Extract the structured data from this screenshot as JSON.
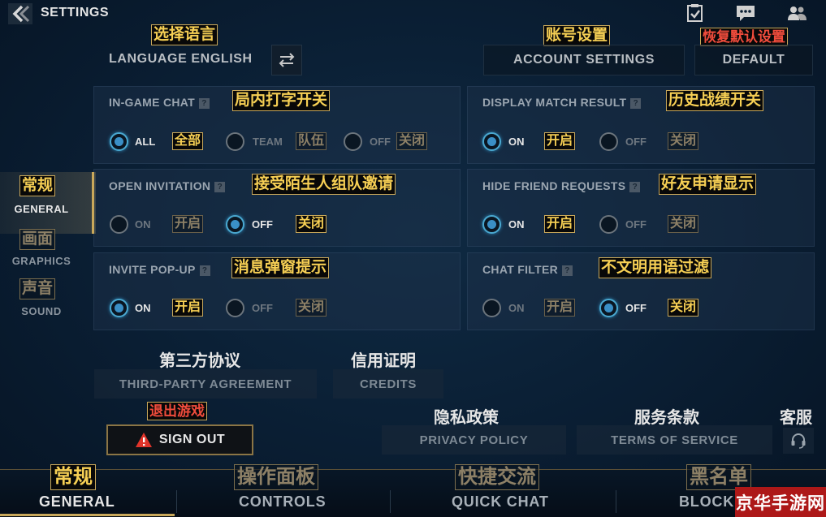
{
  "header": {
    "title": "SETTINGS"
  },
  "captions": {
    "language": "选择语言",
    "account": "账号设置",
    "default": "恢复默认设置",
    "in_game_chat": "局内打字开关",
    "display_match_result": "历史战绩开关",
    "open_invitation": "接受陌生人组队邀请",
    "hide_friend_requests": "好友申请显示",
    "invite_popup": "消息弹窗提示",
    "chat_filter": "不文明用语过滤",
    "sign_out": "退出游戏",
    "opt_all": "全部",
    "opt_team": "队伍",
    "opt_close": "关闭",
    "opt_open": "开启"
  },
  "language": {
    "label": "LANGUAGE ENGLISH",
    "icon": "swap-arrows-icon"
  },
  "top_buttons": {
    "account": "ACCOUNT SETTINGS",
    "default": "DEFAULT"
  },
  "settings": {
    "in_game_chat": {
      "label": "IN-GAME CHAT",
      "options": [
        "ALL",
        "TEAM",
        "OFF"
      ],
      "selected": "ALL"
    },
    "display_match_result": {
      "label": "DISPLAY MATCH RESULT",
      "options": [
        "ON",
        "OFF"
      ],
      "selected": "ON"
    },
    "open_invitation": {
      "label": "OPEN INVITATION",
      "options": [
        "ON",
        "OFF"
      ],
      "selected": "OFF"
    },
    "hide_friend_requests": {
      "label": "HIDE FRIEND REQUESTS",
      "options": [
        "ON",
        "OFF"
      ],
      "selected": "ON"
    },
    "invite_popup": {
      "label": "INVITE POP-UP",
      "options": [
        "ON",
        "OFF"
      ],
      "selected": "ON"
    },
    "chat_filter": {
      "label": "CHAT FILTER",
      "options": [
        "ON",
        "OFF"
      ],
      "selected": "OFF"
    }
  },
  "left_nav": [
    {
      "zh": "常规",
      "label": "GENERAL",
      "active": true
    },
    {
      "zh": "画面",
      "label": "GRAPHICS",
      "active": false
    },
    {
      "zh": "声音",
      "label": "SOUND",
      "active": false
    }
  ],
  "links": {
    "third_party_zh": "第三方协议",
    "third_party": "THIRD-PARTY AGREEMENT",
    "credits_zh": "信用证明",
    "credits": "CREDITS",
    "privacy_zh": "隐私政策",
    "privacy": "PRIVACY POLICY",
    "terms_zh": "服务条款",
    "terms": "TERMS OF SERVICE",
    "support_zh": "客服"
  },
  "sign_out": {
    "label": "SIGN OUT"
  },
  "footer_tabs": [
    {
      "zh": "常规",
      "label": "GENERAL",
      "active": true
    },
    {
      "zh": "操作面板",
      "label": "CONTROLS",
      "active": false
    },
    {
      "zh": "快捷交流",
      "label": "QUICK CHAT",
      "active": false
    },
    {
      "zh": "黑名单",
      "label": "BLOCK",
      "active": false
    }
  ],
  "watermark": "京华手游网",
  "colors": {
    "accent_gold": "#c9a85a",
    "caption_yellow": "#f6cf54",
    "caption_red": "#f04c3c",
    "radio_on": "#3a8fc6",
    "watermark_red": "#ad1818"
  }
}
